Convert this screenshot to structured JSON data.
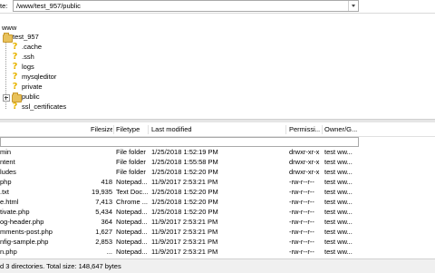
{
  "path_bar": {
    "label": "te:",
    "value": "/www/test_957/public"
  },
  "tree": {
    "root": "www",
    "site": "test_957",
    "children": [
      {
        "label": ".cache",
        "icon": "question-icon"
      },
      {
        "label": ".ssh",
        "icon": "question-icon"
      },
      {
        "label": "logs",
        "icon": "question-icon"
      },
      {
        "label": "mysqleditor",
        "icon": "question-icon"
      },
      {
        "label": "private",
        "icon": "question-icon"
      },
      {
        "label": "public",
        "icon": "folder-icon"
      },
      {
        "label": "ssl_certificates",
        "icon": "question-icon"
      }
    ]
  },
  "list": {
    "headers": {
      "filesize": "Filesize",
      "filetype": "Filetype",
      "last_modified": "Last modified",
      "permissions": "Permissi...",
      "owner": "Owner/G..."
    },
    "rows": [
      {
        "name": "min",
        "size": "",
        "type": "File folder",
        "modified": "1/25/2018 1:52:19 PM",
        "perm": "drwxr-xr-x",
        "owner": "test ww..."
      },
      {
        "name": "ntent",
        "size": "",
        "type": "File folder",
        "modified": "1/25/2018 1:55:58 PM",
        "perm": "drwxr-xr-x",
        "owner": "test ww..."
      },
      {
        "name": "ludes",
        "size": "",
        "type": "File folder",
        "modified": "1/25/2018 1:52:20 PM",
        "perm": "drwxr-xr-x",
        "owner": "test ww..."
      },
      {
        "name": "php",
        "size": "418",
        "type": "Notepad...",
        "modified": "11/9/2017 2:53:21 PM",
        "perm": "-rw-r--r--",
        "owner": "test ww..."
      },
      {
        "name": ".txt",
        "size": "19,935",
        "type": "Text Doc...",
        "modified": "1/25/2018 1:52:20 PM",
        "perm": "-rw-r--r--",
        "owner": "test ww..."
      },
      {
        "name": "e.html",
        "size": "7,413",
        "type": "Chrome ...",
        "modified": "1/25/2018 1:52:20 PM",
        "perm": "-rw-r--r--",
        "owner": "test ww..."
      },
      {
        "name": "tivate.php",
        "size": "5,434",
        "type": "Notepad...",
        "modified": "1/25/2018 1:52:20 PM",
        "perm": "-rw-r--r--",
        "owner": "test ww..."
      },
      {
        "name": "og-header.php",
        "size": "364",
        "type": "Notepad...",
        "modified": "11/9/2017 2:53:21 PM",
        "perm": "-rw-r--r--",
        "owner": "test ww..."
      },
      {
        "name": "mments-post.php",
        "size": "1,627",
        "type": "Notepad...",
        "modified": "11/9/2017 2:53:21 PM",
        "perm": "-rw-r--r--",
        "owner": "test ww..."
      },
      {
        "name": "nfig-sample.php",
        "size": "2,853",
        "type": "Notepad...",
        "modified": "11/9/2017 2:53:21 PM",
        "perm": "-rw-r--r--",
        "owner": "test ww..."
      },
      {
        "name": "n.php",
        "size": "...",
        "type": "Notepad...",
        "modified": "11/9/2017 2:53:21 PM",
        "perm": "-rw-r--r--",
        "owner": "test ww..."
      }
    ]
  },
  "status": {
    "text": "d 3 directories. Total size: 148,647 bytes"
  }
}
